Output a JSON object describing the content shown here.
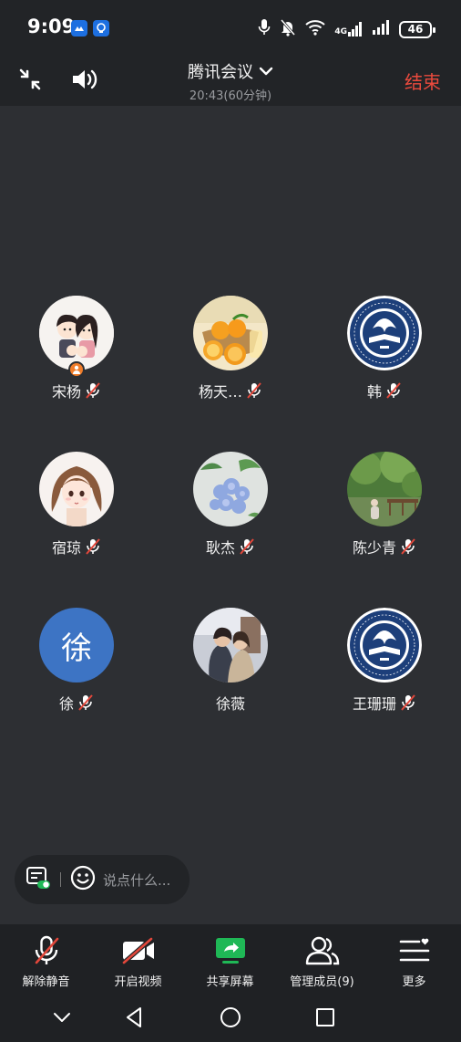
{
  "status_bar": {
    "time": "9:09",
    "network_type": "4G",
    "battery": "46"
  },
  "header": {
    "title": "腾讯会议",
    "duration": "20:43(60分钟)",
    "end_label": "结束"
  },
  "participants": [
    {
      "name": "宋杨",
      "avatar": "cartoon-couple-avatar",
      "host": true,
      "muted": true
    },
    {
      "name": "杨天…",
      "avatar": "oranges-photo-avatar",
      "host": false,
      "muted": true
    },
    {
      "name": "韩",
      "avatar": "university-emblem-avatar",
      "host": false,
      "muted": true
    },
    {
      "name": "宿琼",
      "avatar": "anime-girl-avatar",
      "host": false,
      "muted": true
    },
    {
      "name": "耿杰",
      "avatar": "blue-flowers-avatar",
      "host": false,
      "muted": true
    },
    {
      "name": "陈少青",
      "avatar": "park-photo-avatar",
      "host": false,
      "muted": true
    },
    {
      "name": "徐",
      "avatar_text": "徐",
      "avatar": "letter-avatar",
      "host": false,
      "muted": true,
      "avatar_color": "#3d74c4"
    },
    {
      "name": "徐薇",
      "avatar": "couple-photo-avatar",
      "host": false,
      "muted": false
    },
    {
      "name": "王珊珊",
      "avatar": "university-emblem-avatar",
      "host": false,
      "muted": true
    }
  ],
  "chat": {
    "placeholder": "说点什么..."
  },
  "toolbar": {
    "unmute_label": "解除静音",
    "video_label": "开启视频",
    "share_label": "共享屏幕",
    "members_label": "管理成员(9)",
    "more_label": "更多"
  },
  "colors": {
    "background": "#2d2f33",
    "bar": "#222427",
    "end_red": "#ea4a3d",
    "mute_red": "#e2473b",
    "share_green": "#1fb856"
  }
}
